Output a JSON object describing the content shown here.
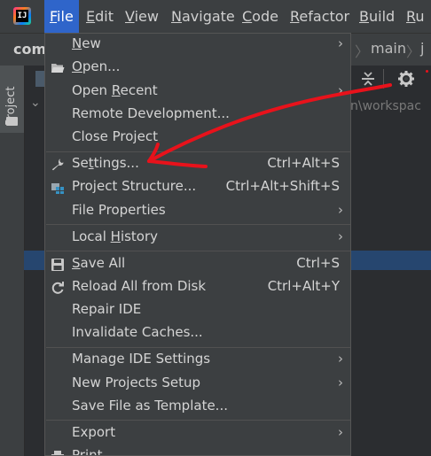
{
  "menubar": {
    "items": [
      {
        "label": "File",
        "ul": "F",
        "rest": "ile"
      },
      {
        "label": "Edit",
        "ul": "E",
        "rest": "dit"
      },
      {
        "label": "View",
        "ul": "V",
        "rest": "iew"
      },
      {
        "label": "Navigate",
        "ul": "N",
        "rest": "avigate"
      },
      {
        "label": "Code",
        "ul": "C",
        "rest": "ode"
      },
      {
        "label": "Refactor",
        "ul": "R",
        "rest": "efactor"
      },
      {
        "label": "Build",
        "ul": "B",
        "rest": "uild"
      },
      {
        "label": "Ru",
        "ul": "R",
        "rest": "u"
      }
    ]
  },
  "toolbar": {
    "project_name": "com",
    "crumb_main": "main",
    "crumb_j": "j"
  },
  "background": {
    "path_text": "n\\workspac",
    "side_tab_label": "Project"
  },
  "file_menu": {
    "new": {
      "ul": "N",
      "rest": "ew"
    },
    "open": {
      "ul": "O",
      "rest": "pen..."
    },
    "open_recent": {
      "pre": "Open ",
      "ul": "R",
      "rest": "ecent"
    },
    "remote_development": "Remote Development...",
    "close_project": "Close Project",
    "settings": {
      "pre": "Se",
      "ul": "t",
      "rest": "tings...",
      "shortcut": "Ctrl+Alt+S"
    },
    "project_structure": {
      "label": "Project Structure...",
      "shortcut": "Ctrl+Alt+Shift+S"
    },
    "file_properties": "File Properties",
    "local_history": {
      "pre": "Local ",
      "ul": "H",
      "rest": "istory"
    },
    "save_all": {
      "ul": "S",
      "rest": "ave All",
      "shortcut": "Ctrl+S"
    },
    "reload_all": {
      "label": "Reload All from Disk",
      "shortcut": "Ctrl+Alt+Y"
    },
    "repair_ide": "Repair IDE",
    "invalidate_caches": "Invalidate Caches...",
    "manage_ide_settings": "Manage IDE Settings",
    "new_projects_setup": "New Projects Setup",
    "save_as_template": "Save File as Template...",
    "export": "Export",
    "print": "Print"
  },
  "colors": {
    "active_menu": "#2f65ca",
    "annotation": "#e8121b"
  }
}
